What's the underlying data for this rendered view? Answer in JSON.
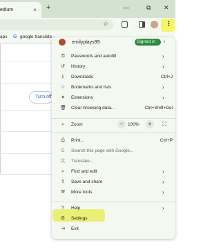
{
  "tab": {
    "title": "edium",
    "close": "×",
    "new_tab": "+"
  },
  "window": {
    "minimize": "—",
    "restore": "⧉",
    "close": "✕"
  },
  "toolbar": {
    "star": "☆",
    "kebab": "⋮"
  },
  "bookmarks": [
    {
      "label": "aps"
    },
    {
      "label": "google translate -",
      "icon": "G"
    }
  ],
  "page": {
    "turn_off": "Turn off"
  },
  "menu": {
    "profile": {
      "name": "emilyplays99",
      "status": "Signed in",
      "chevron": "›"
    },
    "items_top": [
      {
        "label": "Passwords and autofill",
        "icon": "key-icon",
        "glyph": "⚿",
        "chevron": "›",
        "shortcut": ""
      },
      {
        "label": "History",
        "icon": "history-icon",
        "glyph": "↺",
        "chevron": "›",
        "shortcut": ""
      },
      {
        "label": "Downloads",
        "icon": "download-icon",
        "glyph": "⭳",
        "chevron": "",
        "shortcut": "Ctrl+J"
      },
      {
        "label": "Bookmarks and lists",
        "icon": "star-icon",
        "glyph": "☆",
        "chevron": "›",
        "shortcut": ""
      },
      {
        "label": "Extensions",
        "icon": "puzzle-icon",
        "glyph": "✦",
        "chevron": "›",
        "shortcut": ""
      },
      {
        "label": "Clear browsing data...",
        "icon": "trash-icon",
        "glyph": "🗑",
        "chevron": "",
        "shortcut": "Ctrl+Shift+Del"
      }
    ],
    "zoom": {
      "label": "Zoom",
      "glyph": "⌕",
      "minus": "−",
      "value": "100%",
      "plus": "+",
      "fullscreen": "⛶"
    },
    "items_mid": [
      {
        "label": "Print...",
        "icon": "print-icon",
        "glyph": "⎙",
        "chevron": "",
        "shortcut": "Ctrl+P",
        "dim": false
      },
      {
        "label": "Search this page with Google...",
        "icon": "google-icon",
        "glyph": "G",
        "chevron": "",
        "shortcut": "",
        "dim": true
      },
      {
        "label": "Translate...",
        "icon": "translate-icon",
        "glyph": "文",
        "chevron": "",
        "shortcut": "",
        "dim": true
      },
      {
        "label": "Find and edit",
        "icon": "find-icon",
        "glyph": "⌕",
        "chevron": "›",
        "shortcut": "",
        "dim": false
      },
      {
        "label": "Save and share",
        "icon": "share-icon",
        "glyph": "⇪",
        "chevron": "›",
        "shortcut": "",
        "dim": false
      },
      {
        "label": "More tools",
        "icon": "tools-icon",
        "glyph": "⚒",
        "chevron": "›",
        "shortcut": "",
        "dim": false
      }
    ],
    "items_bottom": [
      {
        "label": "Help",
        "icon": "help-icon",
        "glyph": "?",
        "chevron": "›",
        "shortcut": ""
      },
      {
        "label": "Settings",
        "icon": "gear-icon",
        "glyph": "⚙",
        "chevron": "",
        "shortcut": ""
      },
      {
        "label": "Exit",
        "icon": "exit-icon",
        "glyph": "⇥",
        "chevron": "",
        "shortcut": ""
      }
    ]
  },
  "colors": {
    "highlight": "#f4f56a",
    "tabstrip": "#d3e3cf",
    "menu_bg": "#f3f9f0",
    "signed_in": "#2f8a40"
  }
}
